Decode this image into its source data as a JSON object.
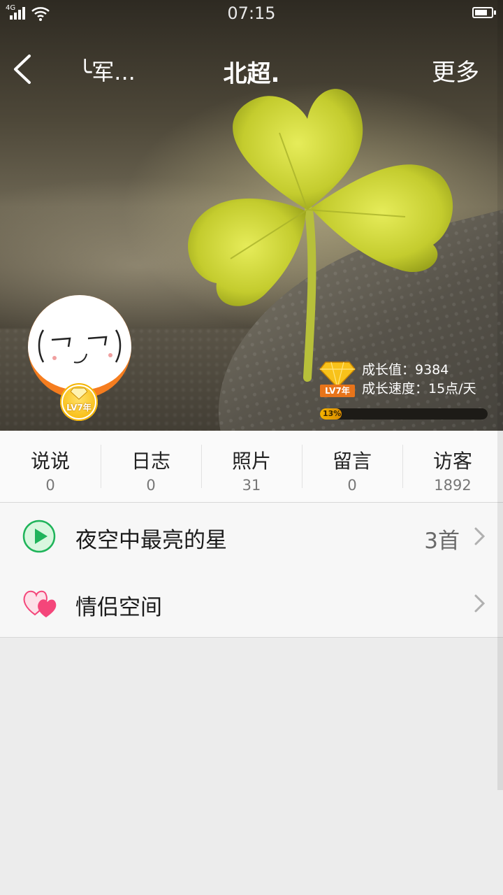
{
  "status_bar": {
    "network": "4G",
    "time": "07:15"
  },
  "nav": {
    "back_title": "╰军...",
    "title": "北超.",
    "more": "更多"
  },
  "avatar": {
    "level_badge": "LV7年"
  },
  "growth": {
    "level": "LV7年",
    "value_text": "成长值：9384",
    "speed_text": "成长速度：15点/天",
    "progress_percent": 13,
    "progress_label": "13%"
  },
  "stats": [
    {
      "label": "说说",
      "count": "0"
    },
    {
      "label": "日志",
      "count": "0"
    },
    {
      "label": "照片",
      "count": "31"
    },
    {
      "label": "留言",
      "count": "0"
    },
    {
      "label": "访客",
      "count": "1892"
    }
  ],
  "music": {
    "label": "夜空中最亮的星",
    "value": "3首",
    "icon": "play-icon"
  },
  "couple": {
    "label": "情侣空间",
    "icon": "double-heart-icon"
  },
  "colors": {
    "accent_green": "#1fb45a",
    "heart_pink": "#f4467a",
    "level_orange": "#f57d1f"
  }
}
